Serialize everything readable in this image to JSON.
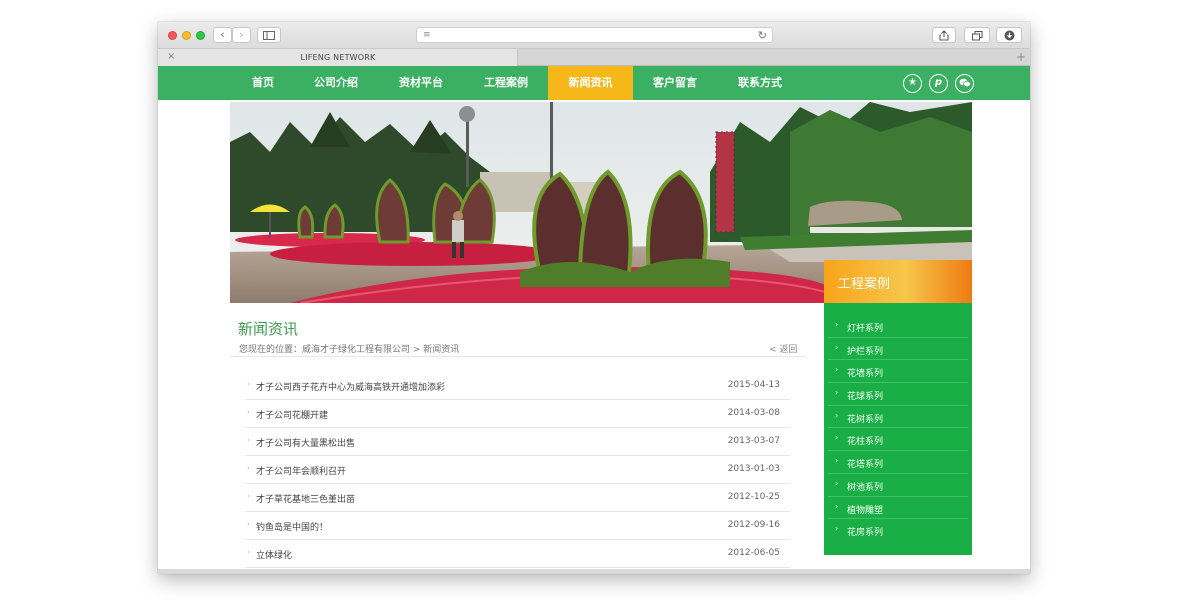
{
  "browser": {
    "tab_title": "LIFENG NETWORK",
    "tab_close": "×",
    "tab_add": "+"
  },
  "site_nav": {
    "items": [
      {
        "label": "首页"
      },
      {
        "label": "公司介绍"
      },
      {
        "label": "资材平台"
      },
      {
        "label": "工程案例"
      },
      {
        "label": "新闻资讯",
        "active": true
      },
      {
        "label": "客户留言"
      },
      {
        "label": "联系方式"
      }
    ],
    "social_icons": [
      "star-icon",
      "pinterest-icon",
      "wechat-icon"
    ],
    "colors": {
      "nav_bg": "#3cb062",
      "active_bg": "#f6b818"
    }
  },
  "page": {
    "title": "新闻资讯",
    "breadcrumb": "您现在的位置：威海才子绿化工程有限公司 > 新闻资讯",
    "back_link": "< 返回"
  },
  "news": [
    {
      "title": "才子公司西子花卉中心为威海高铁开通增加添彩",
      "date": "2015-04-13"
    },
    {
      "title": "才子公司花棚开建",
      "date": "2014-03-08"
    },
    {
      "title": "才子公司有大量黑松出售",
      "date": "2013-03-07"
    },
    {
      "title": "才子公司年会顺利召开",
      "date": "2013-01-03"
    },
    {
      "title": "才子草花基地三色堇出苗",
      "date": "2012-10-25"
    },
    {
      "title": "钓鱼岛是中国的！",
      "date": "2012-09-16"
    },
    {
      "title": "立体绿化",
      "date": "2012-06-05"
    }
  ],
  "sidebar": {
    "title": "工程案例",
    "items": [
      {
        "label": "灯杆系列"
      },
      {
        "label": "护栏系列"
      },
      {
        "label": "花墙系列"
      },
      {
        "label": "花球系列"
      },
      {
        "label": "花树系列"
      },
      {
        "label": "花柱系列"
      },
      {
        "label": "花塔系列"
      },
      {
        "label": "树池系列"
      },
      {
        "label": "植物雕塑"
      },
      {
        "label": "花房系列"
      }
    ],
    "colors": {
      "panel_bg": "#1aae47",
      "header_bg": "#f8a41a"
    }
  }
}
